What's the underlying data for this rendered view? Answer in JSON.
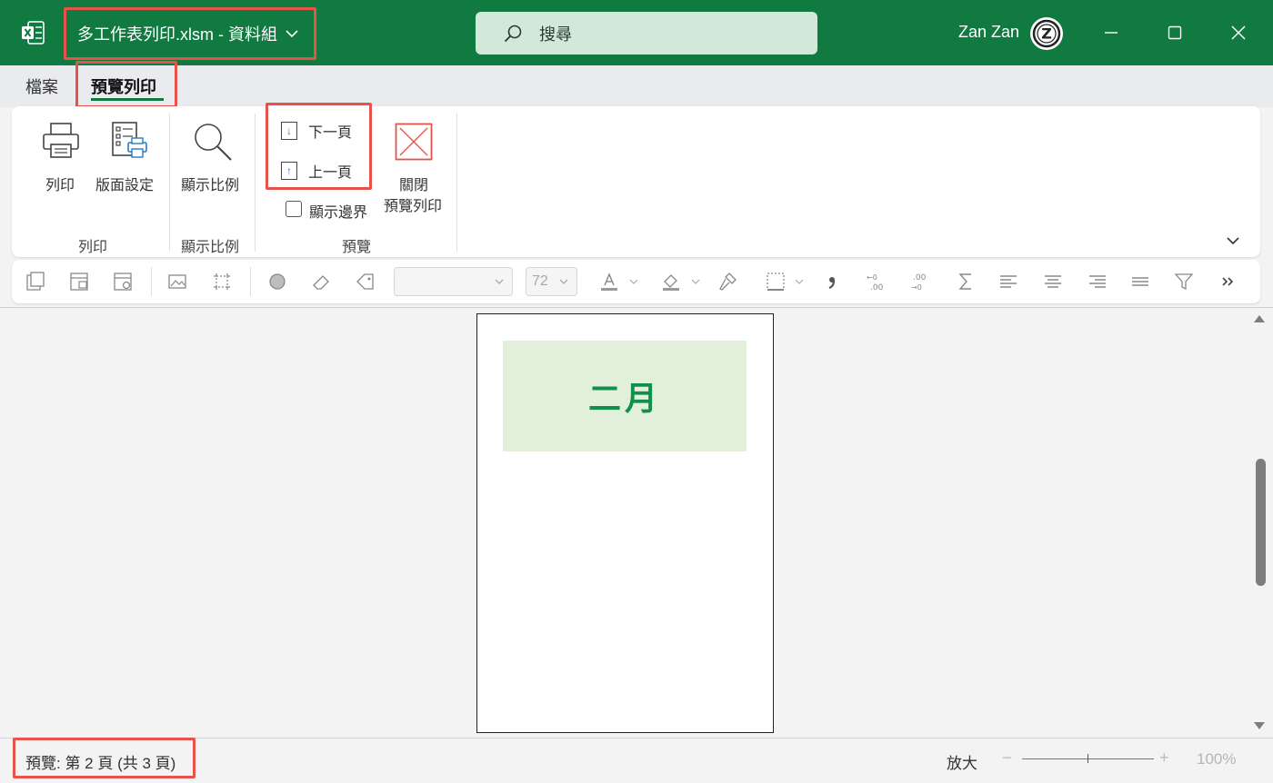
{
  "titlebar": {
    "doc_title": "多工作表列印.xlsm  -  資料組",
    "search_placeholder": "搜尋",
    "user_name": "Zan Zan",
    "avatar_letter": "Z",
    "brand_color": "#117a41"
  },
  "tabs": [
    {
      "label": "檔案",
      "active": false
    },
    {
      "label": "預覽列印",
      "active": true
    }
  ],
  "ribbon": {
    "print_button": "列印",
    "page_setup_button": "版面設定",
    "zoom_button": "顯示比例",
    "next_page_button": "下一頁",
    "prev_page_button": "上一頁",
    "show_margins_checkbox": "顯示邊界",
    "show_margins_checked": false,
    "close_preview_line1": "關閉",
    "close_preview_line2": "預覽列印",
    "groups": {
      "print": "列印",
      "zoom": "顯示比例",
      "preview": "預覽"
    }
  },
  "quick_toolbar": {
    "font_name_value": "",
    "font_size_value": "72"
  },
  "document": {
    "page_heading": "二月",
    "highlight_fill": "#e2efda",
    "heading_color": "#10904a"
  },
  "status": {
    "page_info": "預覽: 第 2 頁 (共 3 頁)",
    "zoom_label": "放大",
    "zoom_minus": "−",
    "zoom_plus": "+",
    "zoom_value": "100%"
  },
  "annotation_color": "#e5534b"
}
